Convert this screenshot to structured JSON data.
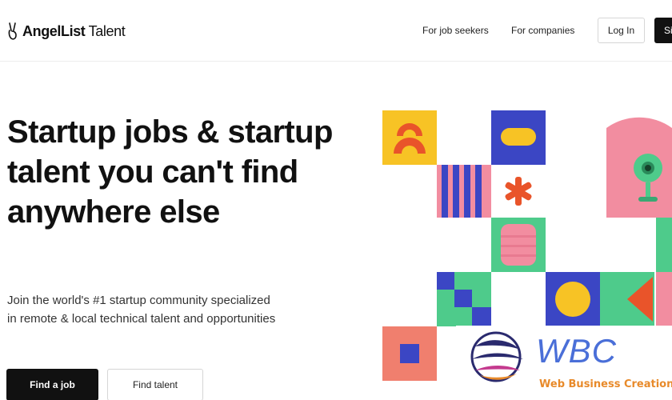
{
  "header": {
    "logo": {
      "bold": "AngelList",
      "light": " Talent"
    },
    "nav": {
      "job_seekers": "For job seekers",
      "companies": "For companies"
    },
    "login_label": "Log In",
    "signup_label": "Si"
  },
  "hero": {
    "title": "Startup jobs & startup talent you can't find anywhere else",
    "subtitle": "Join the world's #1 startup community specialized in remote & local technical talent and opportunities",
    "find_job_label": "Find a job",
    "find_talent_label": "Find talent"
  },
  "watermark": {
    "brand": "WBC",
    "tagline": "Web Business Creation"
  },
  "colors": {
    "yellow": "#f7c325",
    "orange": "#e9542a",
    "blue": "#3b46c4",
    "pink": "#f28da0",
    "green": "#4ecb8b",
    "salmon": "#f07f6e"
  }
}
